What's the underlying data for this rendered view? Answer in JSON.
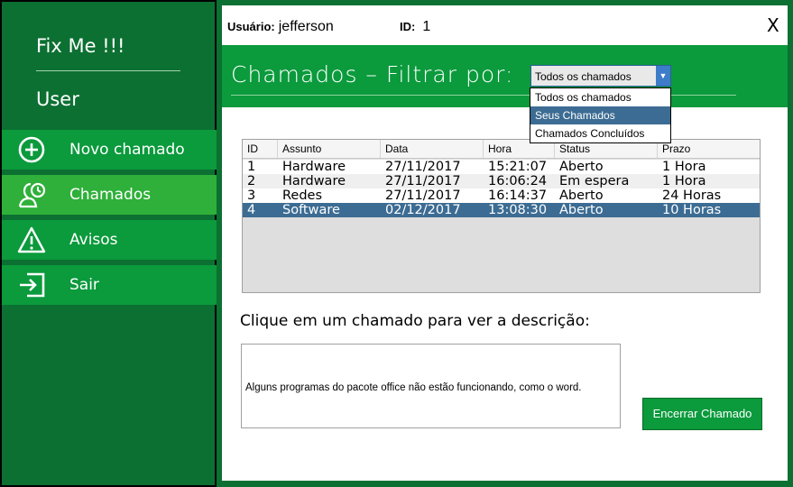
{
  "sidebar": {
    "brand": "Fix Me !!!",
    "user_label": "User",
    "items": [
      {
        "label": "Novo chamado",
        "icon": "plus-circle-icon"
      },
      {
        "label": "Chamados",
        "icon": "support-agent-icon"
      },
      {
        "label": "Avisos",
        "icon": "warning-icon"
      },
      {
        "label": "Sair",
        "icon": "exit-icon"
      }
    ],
    "active_item": "Chamados"
  },
  "header": {
    "user_key": "Usuário:",
    "user_value": "jefferson",
    "id_key": "ID:",
    "id_value": "1",
    "close_label": "X"
  },
  "banner": {
    "title": "Chamados  –  Filtrar  por:",
    "filter_value": "Todos os chamados",
    "filter_options": [
      "Todos os chamados",
      "Seus Chamados",
      "Chamados Concluídos"
    ],
    "highlighted_option": "Seus Chamados"
  },
  "table": {
    "columns": [
      "ID",
      "Assunto",
      "Data",
      "Hora",
      "Status",
      "Prazo"
    ],
    "rows": [
      [
        "1",
        "Hardware",
        "27/11/2017",
        "15:21:07",
        "Aberto",
        "1 Hora"
      ],
      [
        "2",
        "Hardware",
        "27/11/2017",
        "16:06:24",
        "Em espera",
        "1 Hora"
      ],
      [
        "3",
        "Redes",
        "27/11/2017",
        "16:14:37",
        "Aberto",
        "24 Horas"
      ],
      [
        "4",
        "Software",
        "02/12/2017",
        "13:08:30",
        "Aberto",
        "10 Horas"
      ]
    ],
    "selected_row": 4
  },
  "description": {
    "prompt": "Clique em um chamado para ver a descrição:",
    "text": "Alguns programas do pacote office não estão funcionando, como o word."
  },
  "actions": {
    "close_ticket_label": "Encerrar Chamado"
  },
  "colors": {
    "sidebar_dark": "#0c7032",
    "accent_green": "#0b9a3c",
    "active_green": "#2fb03a",
    "selection_blue": "#3c6c93"
  }
}
